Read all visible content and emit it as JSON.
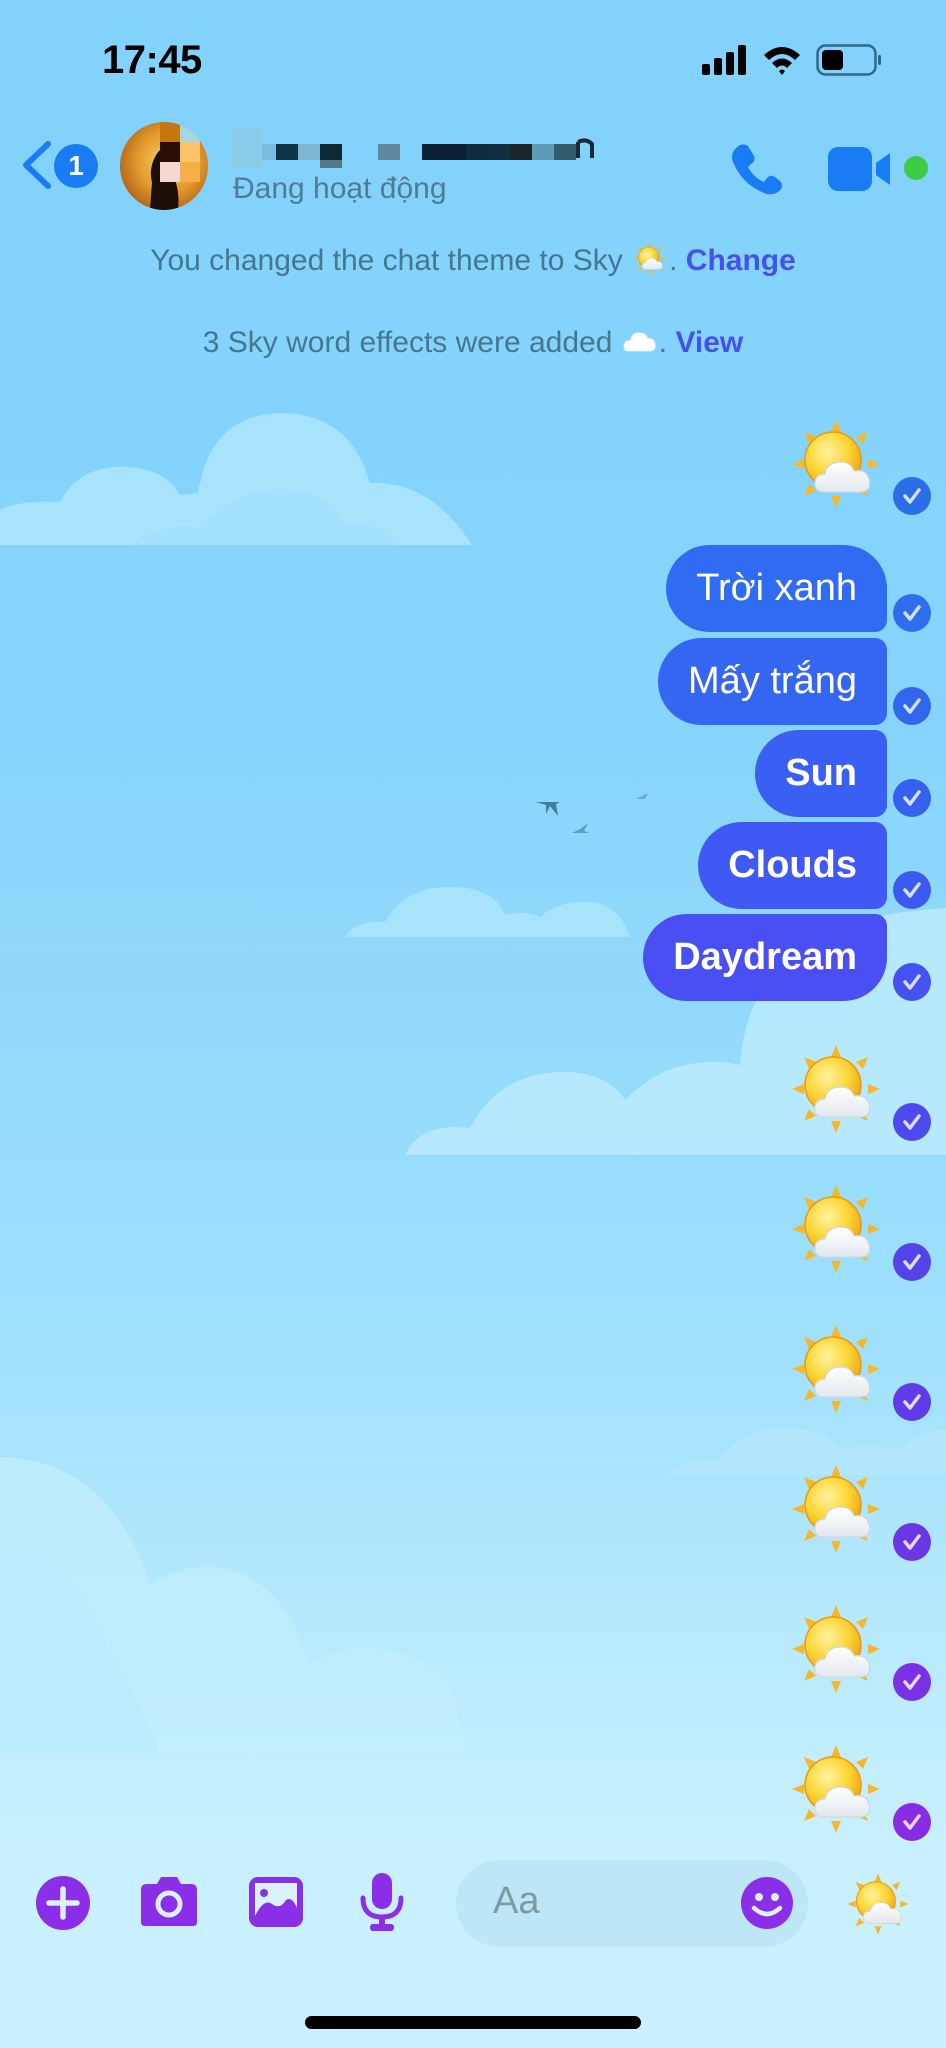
{
  "status_bar": {
    "time": "17:45",
    "icons": [
      "signal-icon",
      "wifi-icon",
      "battery-icon"
    ],
    "battery_level": 0.35
  },
  "header": {
    "back_icon": "chevron-left-icon",
    "unread_badge": "1",
    "contact_name": "[redacted]",
    "presence": "Đang hoạt động",
    "actions": [
      "phone-icon",
      "video-camera-icon"
    ],
    "online": true
  },
  "system_messages": [
    {
      "text": "You changed the chat theme to Sky",
      "emoji": "sun-behind-cloud",
      "link": "Change"
    },
    {
      "text": "3 Sky word effects were added",
      "emoji": "cloud",
      "link": "View"
    }
  ],
  "messages": [
    {
      "type": "emoji",
      "content": "sun-behind-cloud",
      "status": "delivered"
    },
    {
      "type": "text",
      "content": "Trời xanh",
      "status": "delivered"
    },
    {
      "type": "text",
      "content": "Mấy trắng",
      "status": "delivered"
    },
    {
      "type": "text",
      "content": "Sun",
      "status": "delivered",
      "bold": true
    },
    {
      "type": "text",
      "content": "Clouds",
      "status": "delivered",
      "bold": true
    },
    {
      "type": "text",
      "content": "Daydream",
      "status": "delivered",
      "bold": true
    },
    {
      "type": "emoji",
      "content": "sun-behind-cloud",
      "status": "delivered"
    },
    {
      "type": "emoji",
      "content": "sun-behind-cloud",
      "status": "delivered"
    },
    {
      "type": "emoji",
      "content": "sun-behind-cloud",
      "status": "delivered"
    },
    {
      "type": "emoji",
      "content": "sun-behind-cloud",
      "status": "delivered"
    },
    {
      "type": "emoji",
      "content": "sun-behind-cloud",
      "status": "delivered"
    },
    {
      "type": "emoji",
      "content": "sun-behind-cloud",
      "status": "delivered"
    }
  ],
  "composer": {
    "tools": [
      "plus-icon",
      "camera-icon",
      "image-icon",
      "microphone-icon"
    ],
    "placeholder": "Aa",
    "emoji_button": "smiley-icon",
    "quick_reaction": "sun-behind-cloud"
  },
  "colors": {
    "bubble_top": "#2f6cf2",
    "bubble_bottom": "#4b4cf4",
    "check_top": "#2a6de6",
    "check_bottom": "#8a2be2",
    "tool_purple": "#8b2ee8",
    "link": "#4552e8",
    "header_blue": "#1a7cf4",
    "online_green": "#3dcb44"
  }
}
